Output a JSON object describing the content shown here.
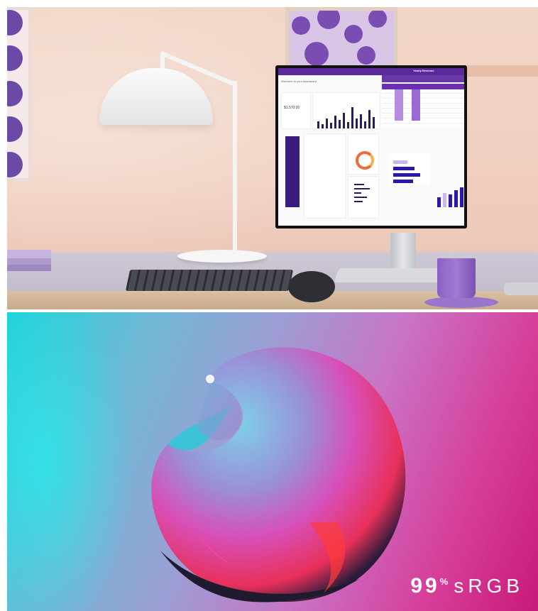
{
  "top_photo": {
    "monitor_screen": {
      "app_title": "Yearly Revenue",
      "dashboard_heading": "Welcome to your dashboard",
      "total_amount": "$1,570.00"
    }
  },
  "render_panel": {
    "badge": {
      "value": "99",
      "unit": "%",
      "label": "sRGB"
    }
  },
  "colors": {
    "accent_purple": "#5b2a9a",
    "render_cyan": "#1fd2d8",
    "render_magenta": "#c81a78"
  }
}
